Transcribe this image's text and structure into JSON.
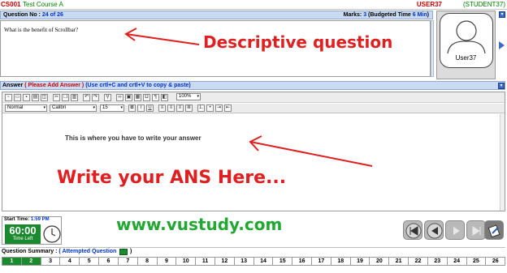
{
  "header": {
    "course_code": "CS001",
    "course_name": "Test Course A",
    "user_id": "USER37",
    "student_id": "(STUDENT37)"
  },
  "question_bar": {
    "label": "Question No :",
    "number": "24 of 26",
    "marks_label": "Marks:",
    "marks_value": "3",
    "budget_label": "(Budgeted Time",
    "budget_value": "6 Min",
    "budget_close": ")"
  },
  "question": {
    "text": "What is the benefit of Scrollbar?"
  },
  "user_panel": {
    "username": "User37"
  },
  "answer_bar": {
    "label": "Answer",
    "instruction": "( Please Add Answer )",
    "copy_hint": "(Use crtl+C and crtl+V to copy & paste)"
  },
  "toolbar": {
    "style_select": "Normal",
    "font_select": "Calibri",
    "size_select": "15",
    "zoom_select": "100%"
  },
  "editor": {
    "hint": "This is where you have to write your answer"
  },
  "annotations": {
    "descriptive": "Descriptive question",
    "write_here": "Write your ANS Here...",
    "website": "www.vustudy.com"
  },
  "timer": {
    "start_label": "Start Time:",
    "start_value": "1:59 PM",
    "time_value": "60:00",
    "time_left_label": "Time Left"
  },
  "summary": {
    "label": "Question Summary :",
    "legend_label": "( Attempted Question",
    "close": ")",
    "questions": [
      "1",
      "2",
      "3",
      "4",
      "5",
      "6",
      "7",
      "8",
      "9",
      "10",
      "11",
      "12",
      "13",
      "14",
      "15",
      "16",
      "17",
      "18",
      "19",
      "20",
      "21",
      "22",
      "23",
      "24",
      "25",
      "26"
    ],
    "attempted": [
      "1",
      "2"
    ]
  },
  "colors": {
    "accent_red": "#cc0000",
    "accent_green": "#1a8a2e",
    "accent_blue": "#0033cc",
    "bar_bg": "#c9daf2"
  }
}
